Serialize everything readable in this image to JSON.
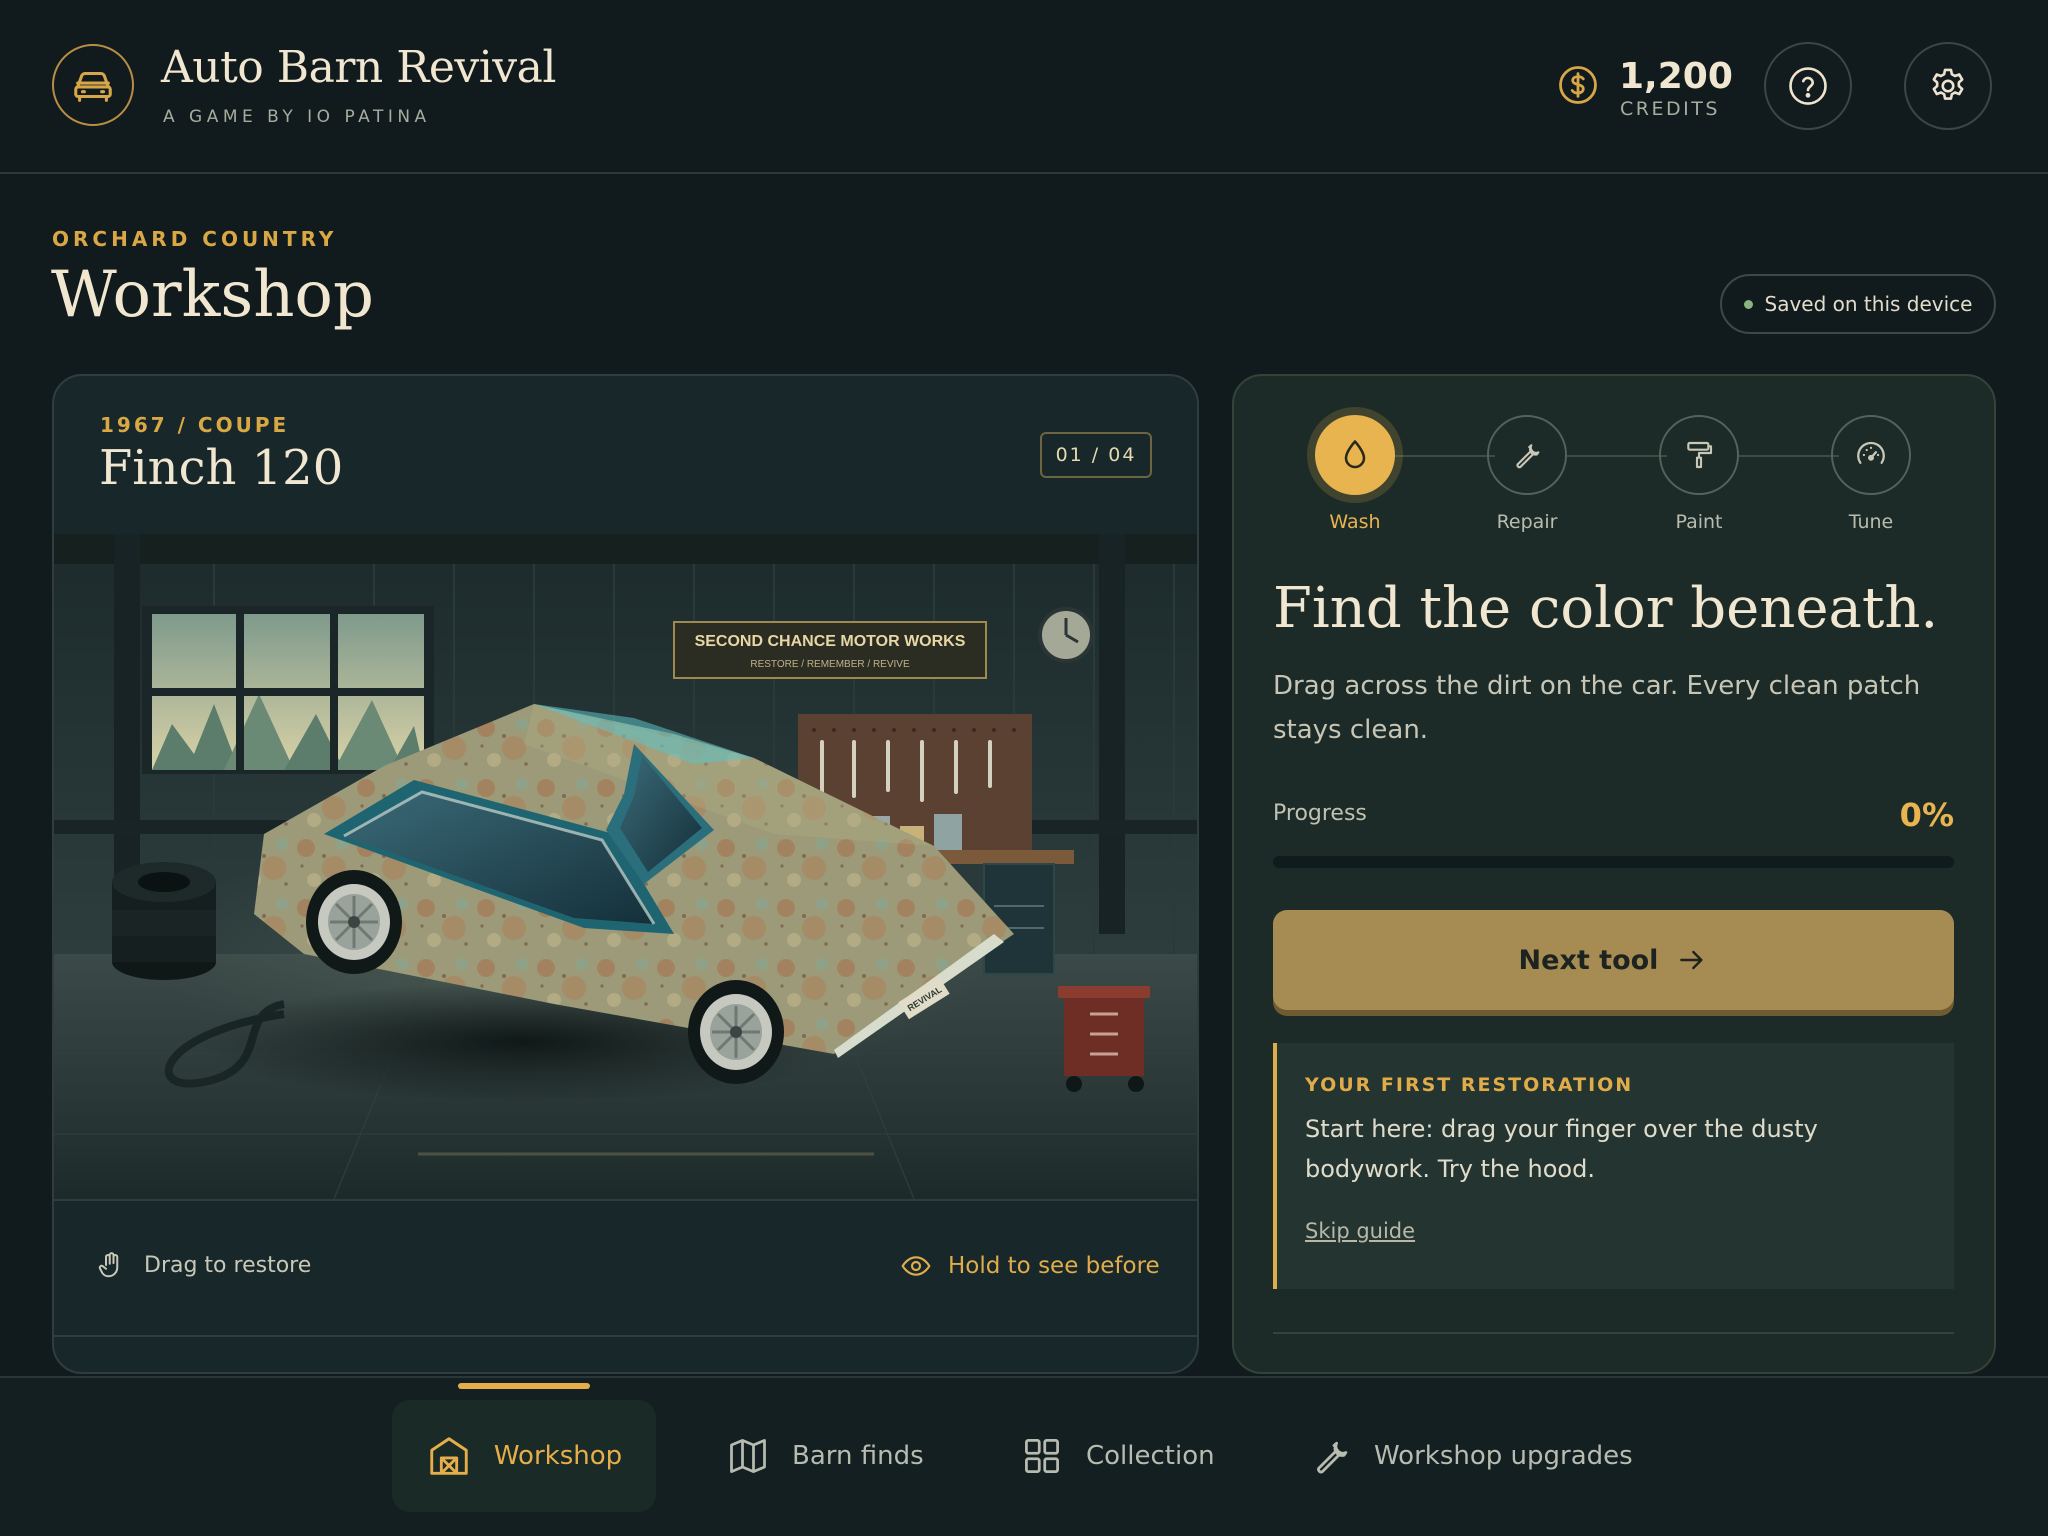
{
  "app": {
    "title": "Auto Barn Revival",
    "subtitle": "A GAME BY IO PATINA"
  },
  "header": {
    "credits_value": "1,200",
    "credits_label": "CREDITS"
  },
  "page": {
    "region": "ORCHARD COUNTRY",
    "title": "Workshop",
    "saved_status": "Saved on this device"
  },
  "car": {
    "year_type": "1967 / COUPE",
    "name": "Finch 120",
    "counter": "01 / 04",
    "sign_title": "SECOND CHANCE MOTOR WORKS",
    "sign_subtitle": "RESTORE / REMEMBER / REVIVE",
    "plate": "REVIVAL",
    "hint_drag": "Drag to restore",
    "hint_hold": "Hold to see before"
  },
  "tools": [
    {
      "label": "Wash",
      "icon": "droplet-icon",
      "active": true
    },
    {
      "label": "Repair",
      "icon": "wrench-icon",
      "active": false
    },
    {
      "label": "Paint",
      "icon": "paint-roller-icon",
      "active": false
    },
    {
      "label": "Tune",
      "icon": "gauge-icon",
      "active": false
    }
  ],
  "panel": {
    "title": "Find the color beneath.",
    "description": "Drag across the dirt on the car. Every clean patch stays clean.",
    "progress_label": "Progress",
    "progress_value": "0%",
    "progress_fraction": 0,
    "next_button": "Next tool"
  },
  "guide": {
    "heading": "YOUR FIRST RESTORATION",
    "body": "Start here: drag your finger over the dusty bodywork. Try the hood.",
    "skip": "Skip guide"
  },
  "nav": [
    {
      "label": "Workshop",
      "icon": "barn-icon",
      "active": true
    },
    {
      "label": "Barn finds",
      "icon": "map-icon",
      "active": false
    },
    {
      "label": "Collection",
      "icon": "grid-icon",
      "active": false
    },
    {
      "label": "Workshop upgrades",
      "icon": "wrench-icon",
      "active": false
    }
  ],
  "colors": {
    "background": "#111b1d",
    "accent": "#e8b44f",
    "button": "#a68c52",
    "text": "#f1e6d0"
  }
}
